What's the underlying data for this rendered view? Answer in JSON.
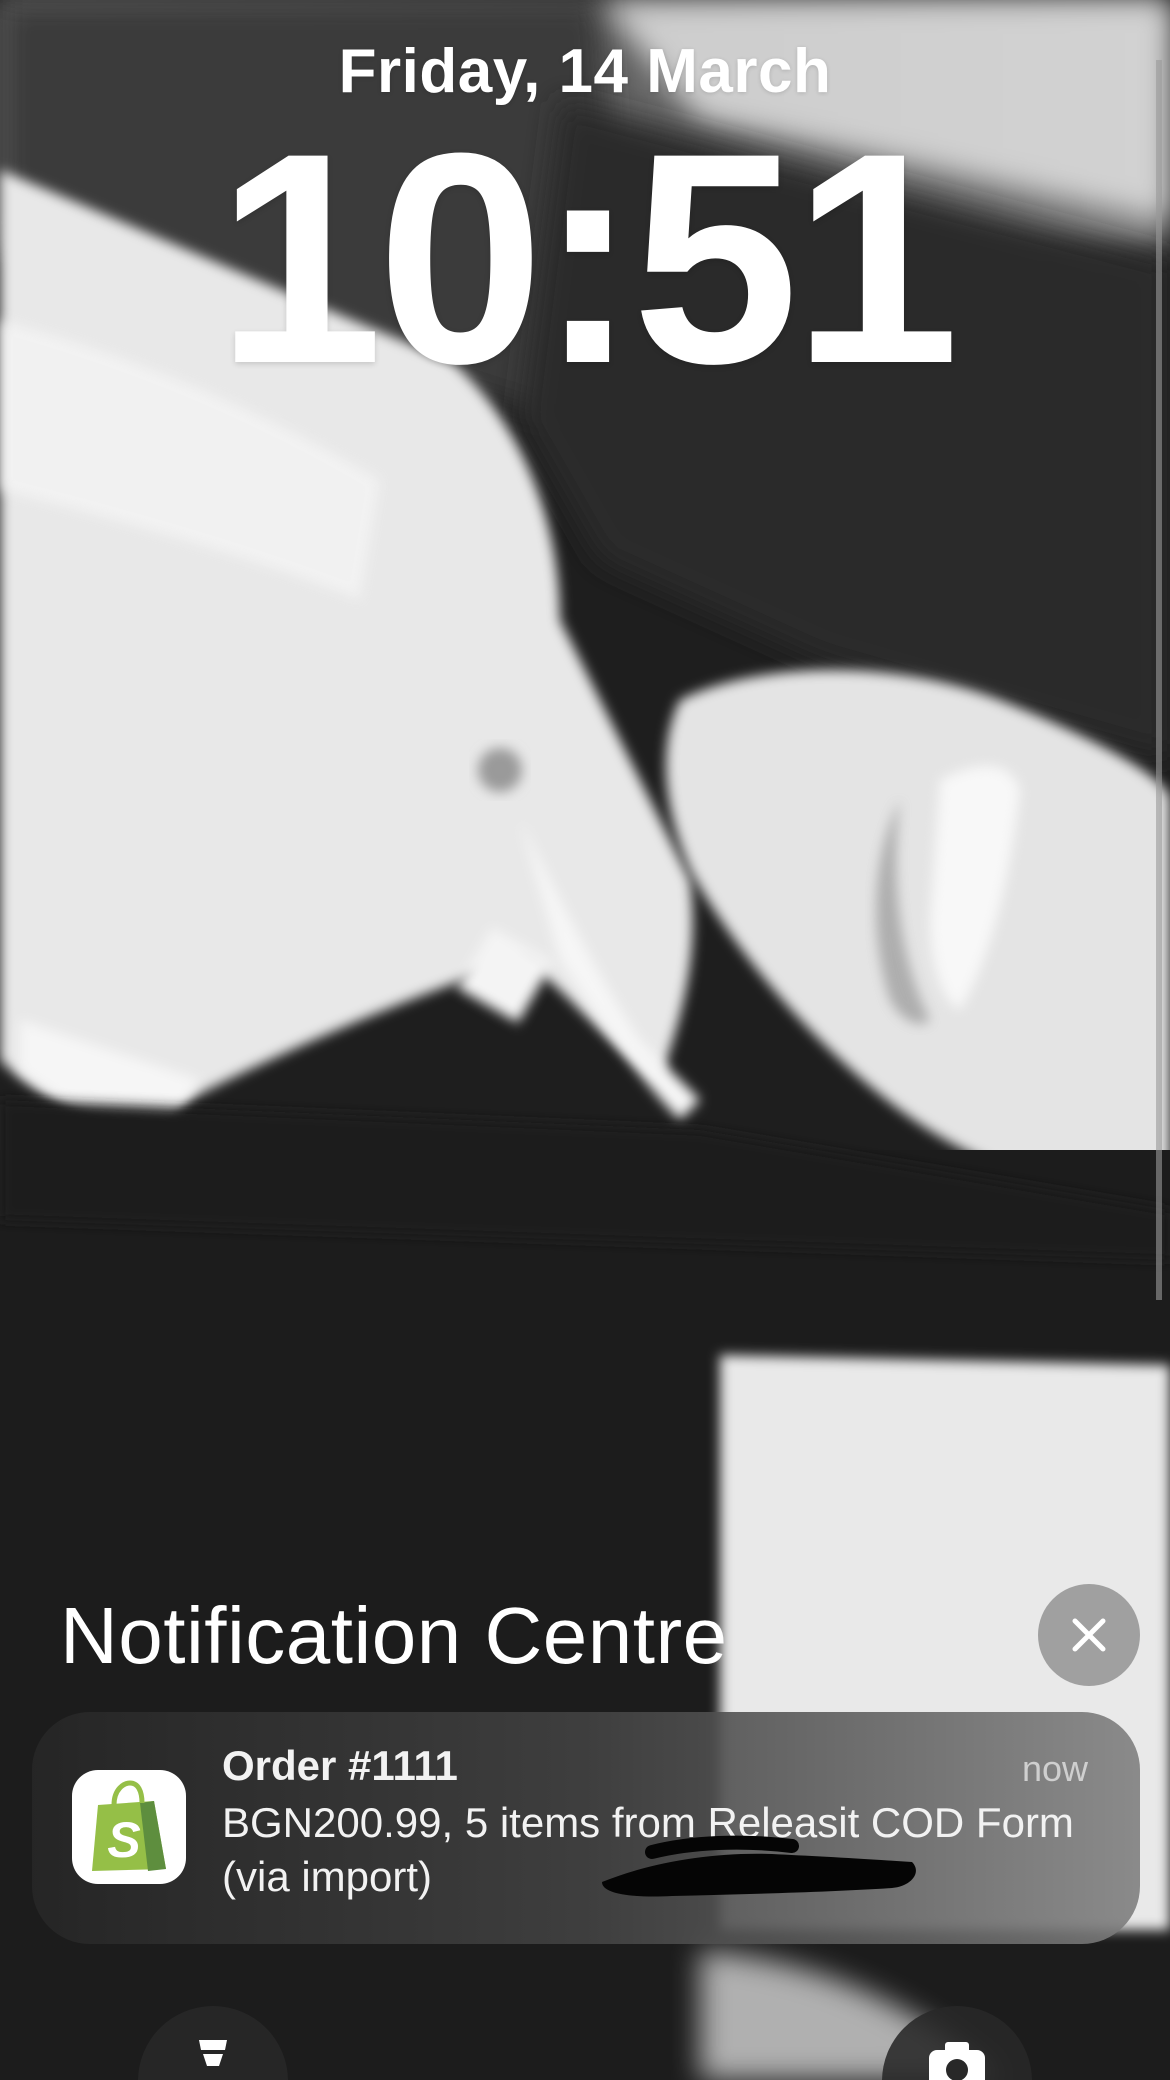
{
  "lock_screen": {
    "date": "Friday, 14 March",
    "time": "10:51"
  },
  "notification_centre": {
    "title": "Notification Centre",
    "close_icon": "close-icon"
  },
  "notification": {
    "app_icon": "shopify-bag-icon",
    "title": "Order #1111",
    "timestamp": "now",
    "body": "BGN200.99, 5 items from Releasit COD Form (via import)",
    "accent_color": "#95bf47"
  },
  "quick_actions": {
    "left_icon": "flashlight-icon",
    "right_icon": "camera-icon"
  }
}
